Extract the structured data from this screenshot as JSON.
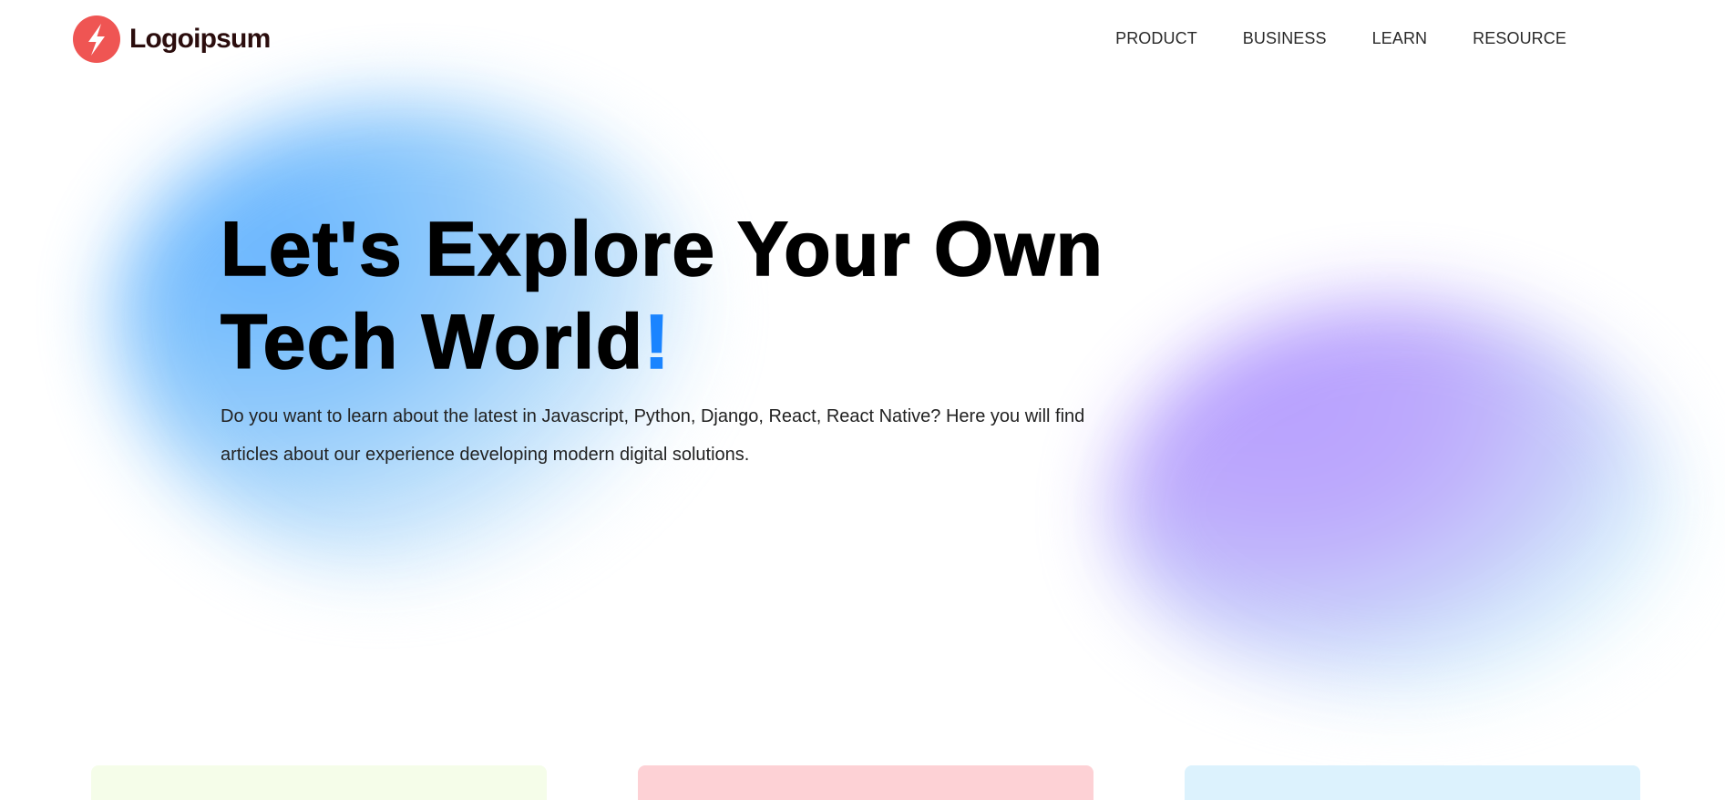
{
  "header": {
    "logo_text": "Logoipsum",
    "nav": [
      {
        "label": "PRODUCT"
      },
      {
        "label": "BUSINESS"
      },
      {
        "label": "LEARN"
      },
      {
        "label": "RESOURCE"
      }
    ]
  },
  "hero": {
    "title_part1": "Let's Explore Your Own Tech World",
    "title_accent": "!",
    "description": "Do you want to learn about the latest in Javascript, Python, Django, React, React Native? Here you will find articles about our experience developing modern digital solutions."
  },
  "colors": {
    "brand": "#ef5553",
    "accent": "#1a84ff",
    "card_1": "#f5fde9",
    "card_2": "#fdd1d5",
    "card_3": "#dcf2fd"
  },
  "icons": {
    "logo": "lightning-bolt-icon"
  }
}
